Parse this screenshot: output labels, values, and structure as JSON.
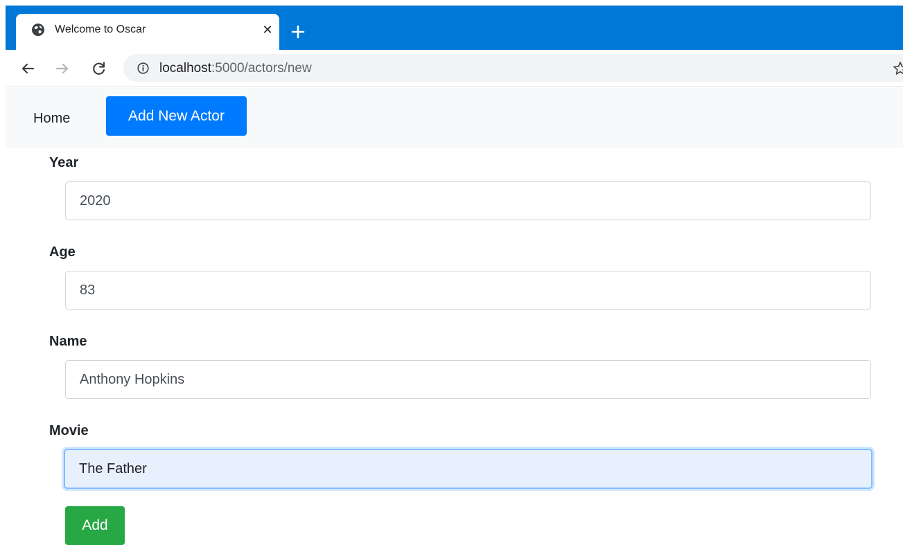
{
  "browser": {
    "tab_title": "Welcome to Oscar",
    "tab_close": "✕",
    "url_host": "localhost",
    "url_path": ":5000/actors/new",
    "colors": {
      "tabstrip": "#0078d7",
      "omnibox": "#f1f3f4"
    }
  },
  "navbar": {
    "home_label": "Home",
    "add_actor_label": "Add New Actor",
    "colors": {
      "primary": "#007bff"
    }
  },
  "form": {
    "fields": [
      {
        "label": "Year",
        "value": "2020"
      },
      {
        "label": "Age",
        "value": "83"
      },
      {
        "label": "Name",
        "value": "Anthony Hopkins"
      },
      {
        "label": "Movie",
        "value": "The Father"
      }
    ],
    "submit_label": "Add",
    "colors": {
      "submit": "#28a745",
      "focus_fill": "#e8f0fe",
      "focus_border": "#80bdff"
    }
  }
}
